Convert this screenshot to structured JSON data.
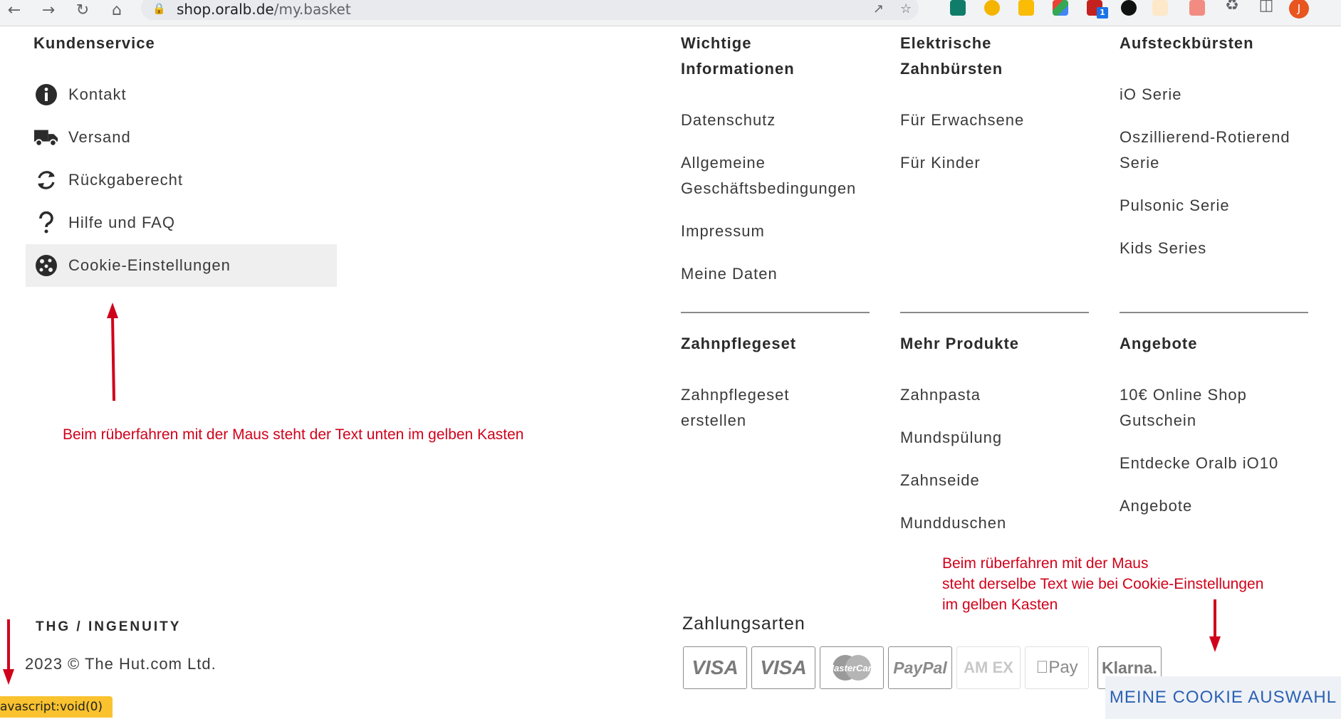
{
  "browser": {
    "url_host": "shop.oralb.de",
    "url_path": "/my.basket",
    "extension_badge": "1",
    "profile_initial": "J"
  },
  "kundenservice": {
    "heading": "Kundenservice",
    "items": [
      {
        "label": "Kontakt",
        "icon": "info-icon"
      },
      {
        "label": "Versand",
        "icon": "truck-icon"
      },
      {
        "label": "Rückgaberecht",
        "icon": "return-icon"
      },
      {
        "label": "Hilfe und FAQ",
        "icon": "question-icon"
      },
      {
        "label": "Cookie-Einstellungen",
        "icon": "cookie-icon"
      }
    ]
  },
  "wichtige": {
    "heading_l1": "Wichtige",
    "heading_l2": "Informationen",
    "links": [
      "Datenschutz",
      "Allgemeine",
      "Geschäftsbedingungen",
      "Impressum",
      "Meine Daten"
    ]
  },
  "elektrische": {
    "heading_l1": "Elektrische",
    "heading_l2": "Zahnbürsten",
    "links": [
      "Für Erwachsene",
      "Für Kinder"
    ]
  },
  "aufsteck": {
    "heading": "Aufsteckbürsten",
    "links": [
      "iO Serie",
      "Oszillierend-Rotierend",
      "Serie",
      "Pulsonic Serie",
      "Kids Series"
    ]
  },
  "zahnpflegeset": {
    "heading": "Zahnpflegeset",
    "links": [
      "Zahnpflegeset",
      "erstellen"
    ]
  },
  "mehr": {
    "heading": "Mehr Produkte",
    "links": [
      "Zahnpasta",
      "Mundspülung",
      "Zahnseide",
      "Mundduschen"
    ]
  },
  "angebote": {
    "heading": "Angebote",
    "links": [
      "10€ Online Shop",
      "Gutschein",
      "Entdecke Oralb iO10",
      "Angebote"
    ]
  },
  "annotations": {
    "left": "Beim rüberfahren mit der Maus steht der Text unten im gelben Kasten",
    "right_l1": "Beim rüberfahren mit der Maus",
    "right_l2": "steht derselbe Text wie bei Cookie-Einstellungen",
    "right_l3": "im gelben Kasten"
  },
  "brand": "THG / INGENUITY",
  "copyright": "2023 © The Hut.com Ltd.",
  "status_bar": "avascript:void(0)",
  "payment": {
    "title": "Zahlungsarten",
    "methods": [
      "VISA",
      "VISA",
      "MasterCard",
      "PayPal",
      "AM EX",
      "Pay",
      "Klarna."
    ]
  },
  "cookie_choice": "MEINE COOKIE AUSWAHL",
  "colors": {
    "annotation": "#d0021b",
    "status_bar": "#f9c22e",
    "cookie_choice_text": "#2b61b3"
  }
}
